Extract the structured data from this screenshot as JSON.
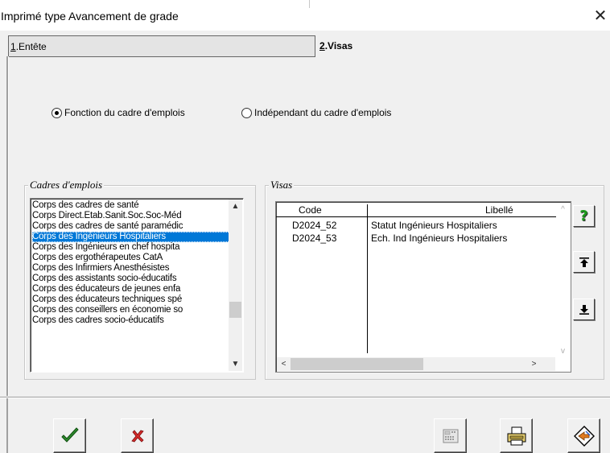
{
  "window": {
    "title": "Imprimé type Avancement de grade",
    "close_label": "✕"
  },
  "tabs": [
    {
      "key": "1",
      "label": "Entête",
      "active": false
    },
    {
      "key": "2",
      "label": "Visas",
      "active": true
    }
  ],
  "radios": {
    "option1": {
      "label": "Fonction du cadre d'emplois",
      "checked": true
    },
    "option2": {
      "label": "Indépendant du cadre d'emplois",
      "checked": false
    }
  },
  "cadres": {
    "title": "Cadres d'emplois",
    "items": [
      "Corps des cadres de santé",
      "Corps Direct.Etab.Sanit.Soc.Soc-Méd",
      "Corps des cadres de santé paramédic",
      "Corps des Ingénieurs Hospitaliers",
      "Corps des Ingénieurs en chef hospita",
      "Corps des ergothérapeutes CatA",
      "Corps des Infirmiers Anesthésistes",
      "Corps des assistants socio-éducatifs",
      "Corps des éducateurs de jeunes enfa",
      "Corps des éducateurs techniques spé",
      "Corps des conseillers en économie so",
      "Corps des cadres socio-éducatifs"
    ],
    "selected_index": 3
  },
  "visas": {
    "title": "Visas",
    "columns": [
      "Code",
      "Libellé"
    ],
    "rows": [
      {
        "code": "D2024_52",
        "libelle": "Statut Ingénieurs Hospitaliers"
      },
      {
        "code": "D2024_53",
        "libelle": "Ech. Ind Ingénieurs Hospitaliers"
      }
    ]
  },
  "side_buttons": {
    "help_glyph": "?"
  },
  "icons": {
    "ok": "checkmark-icon",
    "cancel": "x-icon",
    "calc": "calculator-icon",
    "print": "printer-icon",
    "exit": "exit-icon",
    "up": "move-up-icon",
    "down": "move-down-icon"
  }
}
